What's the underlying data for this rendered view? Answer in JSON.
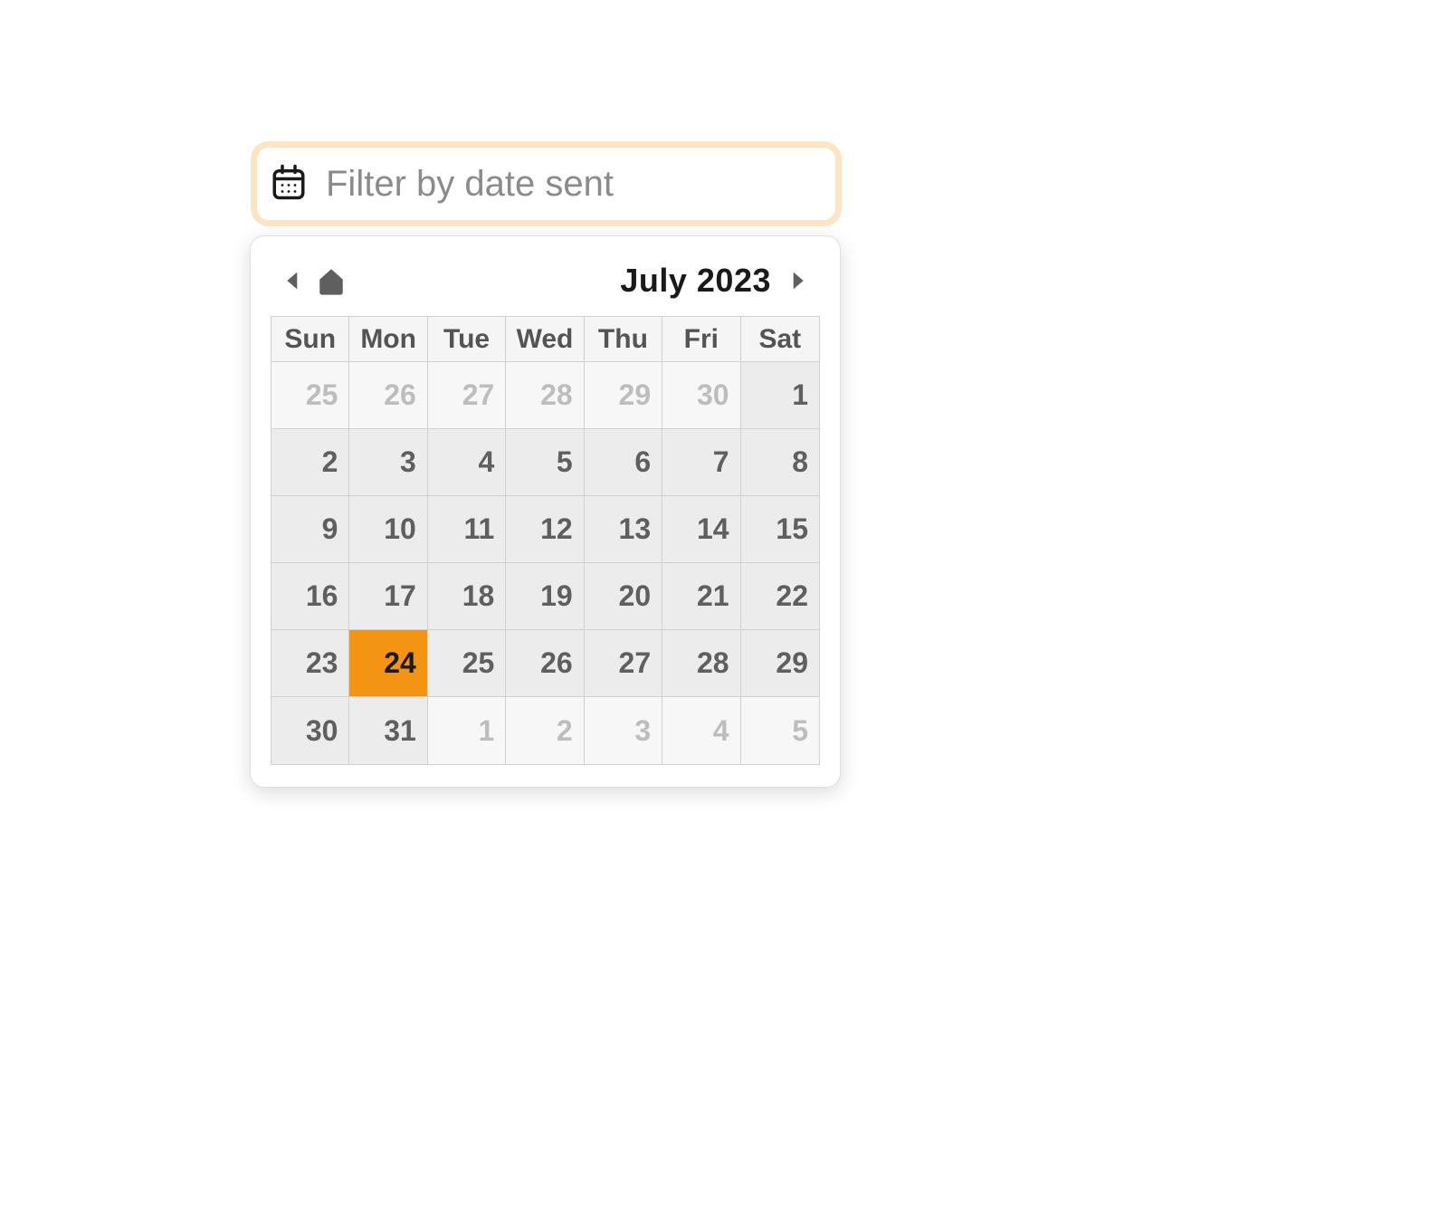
{
  "input": {
    "placeholder": "Filter by date sent",
    "value": ""
  },
  "calendar": {
    "month_label": "July 2023",
    "weekdays": [
      "Sun",
      "Mon",
      "Tue",
      "Wed",
      "Thu",
      "Fri",
      "Sat"
    ],
    "days": [
      {
        "n": "25",
        "type": "out"
      },
      {
        "n": "26",
        "type": "out"
      },
      {
        "n": "27",
        "type": "out"
      },
      {
        "n": "28",
        "type": "out"
      },
      {
        "n": "29",
        "type": "out"
      },
      {
        "n": "30",
        "type": "out"
      },
      {
        "n": "1",
        "type": "day"
      },
      {
        "n": "2",
        "type": "day"
      },
      {
        "n": "3",
        "type": "day"
      },
      {
        "n": "4",
        "type": "day"
      },
      {
        "n": "5",
        "type": "day"
      },
      {
        "n": "6",
        "type": "day"
      },
      {
        "n": "7",
        "type": "day"
      },
      {
        "n": "8",
        "type": "day"
      },
      {
        "n": "9",
        "type": "day"
      },
      {
        "n": "10",
        "type": "day"
      },
      {
        "n": "11",
        "type": "day"
      },
      {
        "n": "12",
        "type": "day"
      },
      {
        "n": "13",
        "type": "day"
      },
      {
        "n": "14",
        "type": "day"
      },
      {
        "n": "15",
        "type": "day"
      },
      {
        "n": "16",
        "type": "day"
      },
      {
        "n": "17",
        "type": "day"
      },
      {
        "n": "18",
        "type": "day"
      },
      {
        "n": "19",
        "type": "day"
      },
      {
        "n": "20",
        "type": "day"
      },
      {
        "n": "21",
        "type": "day"
      },
      {
        "n": "22",
        "type": "day"
      },
      {
        "n": "23",
        "type": "day"
      },
      {
        "n": "24",
        "type": "sel"
      },
      {
        "n": "25",
        "type": "day"
      },
      {
        "n": "26",
        "type": "day"
      },
      {
        "n": "27",
        "type": "day"
      },
      {
        "n": "28",
        "type": "day"
      },
      {
        "n": "29",
        "type": "day"
      },
      {
        "n": "30",
        "type": "day"
      },
      {
        "n": "31",
        "type": "day"
      },
      {
        "n": "1",
        "type": "out"
      },
      {
        "n": "2",
        "type": "out"
      },
      {
        "n": "3",
        "type": "out"
      },
      {
        "n": "4",
        "type": "out"
      },
      {
        "n": "5",
        "type": "out"
      }
    ]
  },
  "colors": {
    "accent": "#f39412",
    "input_border": "#fde4c3"
  }
}
